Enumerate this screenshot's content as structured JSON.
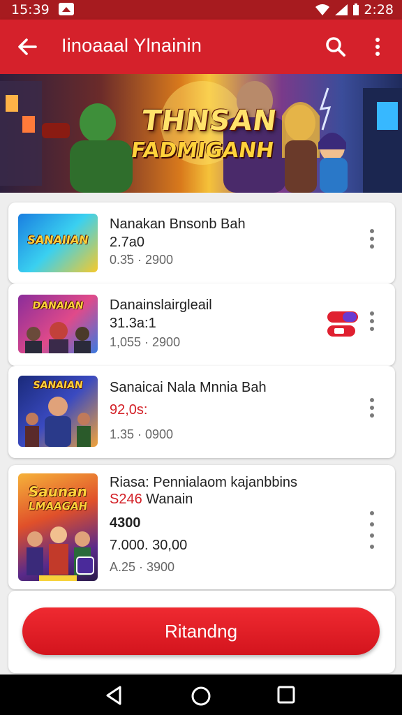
{
  "status_bar": {
    "time": "15:39",
    "right_text": "2:28"
  },
  "app_bar": {
    "title": "Iinoaaal Ylnainin"
  },
  "banner": {
    "title_line1": "THNSAN",
    "title_line2": "FADMIGANH"
  },
  "items": [
    {
      "thumb_label": "SANAIIAN",
      "title": "Nanakan Bnsonb Bah",
      "subtitle": "2.7a0",
      "meta": "0.3̃5 · 2900"
    },
    {
      "thumb_label": "DANAIAN",
      "title": "Danainslairgleail",
      "subtitle": "31.3a:1",
      "meta": "1,055 · 2900"
    },
    {
      "thumb_label": "SANAIAN",
      "title": "Sanaicai Nala Mnnia Bah",
      "subtitle": "92,0s:",
      "meta": "1.35 · 0900",
      "subtitle_color": "#d32027"
    },
    {
      "thumb_label": "Saunan",
      "thumb_label2": "LMAAGAH",
      "title": "Riasa: Pennialaom kajanbbins",
      "title_accent": "S246",
      "title_line2": "Wanain",
      "value": "4300",
      "subtitle": "7.000. 30,00",
      "meta": "A.25 · 3900"
    }
  ],
  "cta": {
    "label": "Ritandng"
  },
  "colors": {
    "primary": "#d5212b",
    "status_bar": "#a71b1f",
    "accent_text": "#d32027"
  },
  "icons": [
    "back-arrow-icon",
    "search-icon",
    "more-vert-icon",
    "wifi-icon",
    "signal-icon",
    "battery-icon",
    "nav-back-icon",
    "nav-home-icon",
    "nav-recents-icon",
    "toggle-badge-icon"
  ]
}
